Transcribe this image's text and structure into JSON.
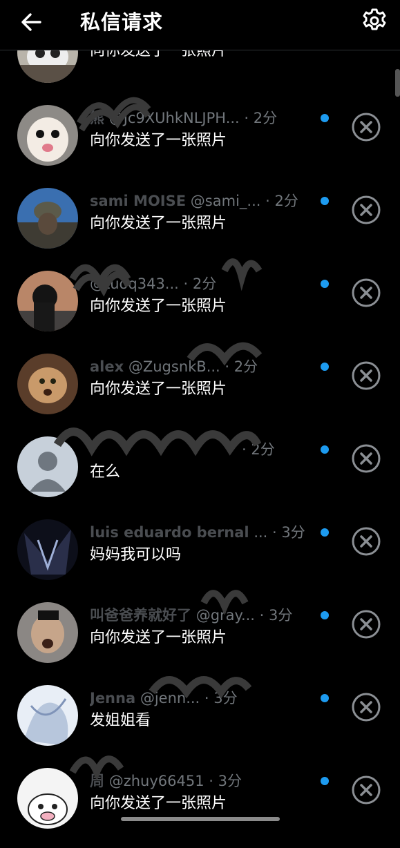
{
  "header": {
    "title": "私信请求",
    "back_icon": "arrow-left-icon",
    "settings_icon": "gear-icon"
  },
  "accent_color": "#1d9bf0",
  "requests": [
    {
      "name": "",
      "handle": "",
      "time": "",
      "message": "向你发送了一张照片",
      "unread": false
    },
    {
      "name": "熊",
      "handle": "@Jc9XUhkNLJPH...",
      "time": "2分",
      "message": "向你发送了一张照片",
      "unread": true
    },
    {
      "name": "sami MOISE",
      "handle": "@sami_...",
      "time": "2分",
      "message": "向你发送了一张照片",
      "unread": true
    },
    {
      "name": "",
      "handle": "@tuoq343...",
      "time": "2分",
      "message": "向你发送了一张照片",
      "unread": true
    },
    {
      "name": "alex",
      "handle": "@ZugsnkB...",
      "time": "2分",
      "message": "向你发送了一张照片",
      "unread": true
    },
    {
      "name": "",
      "handle": "",
      "time": "2分",
      "message": "在么",
      "unread": true
    },
    {
      "name": "luis eduardo bernal",
      "handle": "...",
      "time": "3分",
      "message": "妈妈我可以吗",
      "unread": true
    },
    {
      "name": "叫爸爸养就好了",
      "handle": "@gray...",
      "time": "3分",
      "message": "向你发送了一张照片",
      "unread": true
    },
    {
      "name": "Jenna",
      "handle": "@jenn...",
      "time": "3分",
      "message": "发姐姐看",
      "unread": true
    },
    {
      "name": "周",
      "handle": "@zhuy66451",
      "time": "3分",
      "message": "向你发送了一张照片",
      "unread": true
    }
  ]
}
